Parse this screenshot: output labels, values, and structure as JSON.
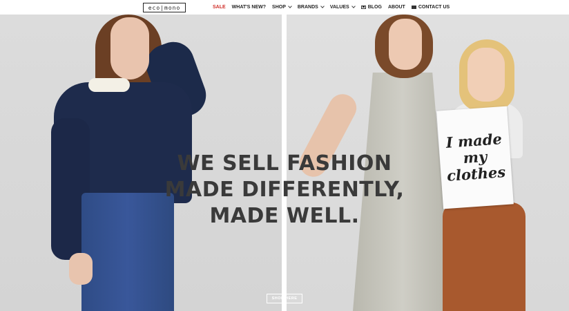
{
  "header": {
    "logo_text": "eco|mono",
    "nav": [
      {
        "label": "SALE",
        "icon": null,
        "dropdown": false,
        "color": "#d0302a"
      },
      {
        "label": "WHAT'S NEW?",
        "icon": null,
        "dropdown": false
      },
      {
        "label": "SHOP",
        "icon": null,
        "dropdown": true
      },
      {
        "label": "BRANDS",
        "icon": null,
        "dropdown": true
      },
      {
        "label": "VALUES",
        "icon": null,
        "dropdown": true
      },
      {
        "label": "BLOG",
        "icon": "image-icon",
        "dropdown": false
      },
      {
        "label": "ABOUT",
        "icon": null,
        "dropdown": false
      },
      {
        "label": "CONTACT US",
        "icon": "envelope-icon",
        "dropdown": false
      }
    ]
  },
  "hero": {
    "headline_lines": [
      "WE SELL FASHION",
      "MADE DIFFERENTLY,",
      "MADE WELL."
    ],
    "sign_text": "I made my clothes",
    "cta_label": "SHOP HERE"
  },
  "colors": {
    "accent_sale": "#d0302a",
    "headline": "#3a3a3a",
    "background": "#ffffff"
  }
}
